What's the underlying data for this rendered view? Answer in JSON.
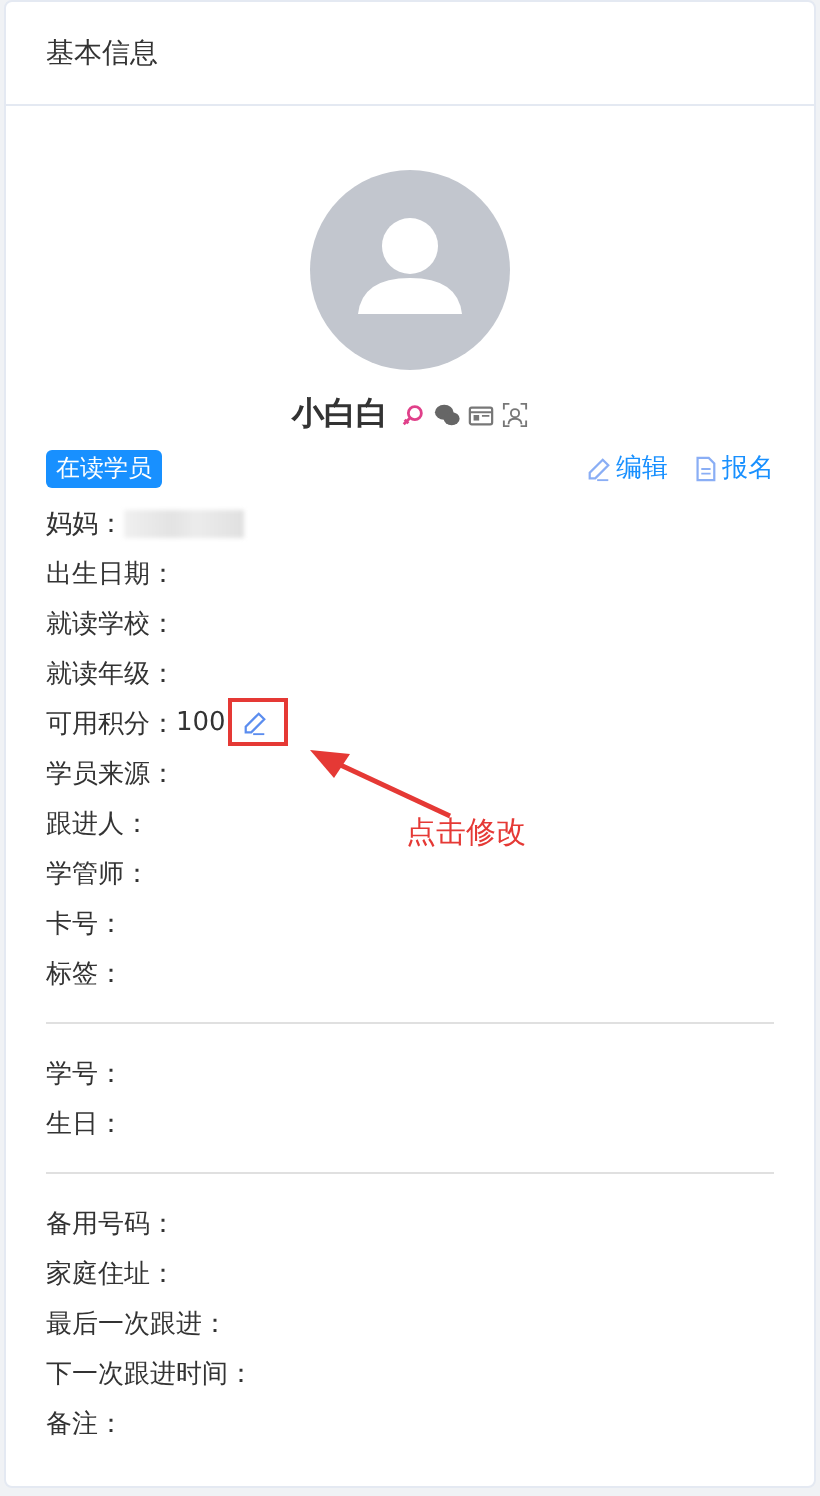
{
  "panel": {
    "title": "基本信息"
  },
  "profile": {
    "name": "小白白",
    "status_badge": "在读学员",
    "actions": [
      "编辑",
      "报名"
    ]
  },
  "field_groups": [
    {
      "fields": [
        {
          "label": "妈妈：",
          "kind": "redacted"
        },
        {
          "label": "出生日期：",
          "kind": "text"
        },
        {
          "label": "就读学校：",
          "kind": "text"
        },
        {
          "label": "就读年级：",
          "kind": "text"
        },
        {
          "label": "可用积分：",
          "kind": "editable",
          "value": "100"
        },
        {
          "label": "学员来源：",
          "kind": "text"
        },
        {
          "label": "跟进人：",
          "kind": "text"
        },
        {
          "label": "学管师：",
          "kind": "text"
        },
        {
          "label": "卡号：",
          "kind": "text"
        },
        {
          "label": "标签：",
          "kind": "text"
        }
      ]
    },
    {
      "fields": [
        {
          "label": "学号：",
          "kind": "text"
        },
        {
          "label": "生日：",
          "kind": "text"
        }
      ]
    },
    {
      "fields": [
        {
          "label": "备用号码：",
          "kind": "text"
        },
        {
          "label": "家庭住址：",
          "kind": "text"
        },
        {
          "label": "最后一次跟进：",
          "kind": "text"
        },
        {
          "label": "下一次跟进时间：",
          "kind": "text"
        },
        {
          "label": "备注：",
          "kind": "text"
        }
      ]
    }
  ],
  "annotation": {
    "text": "点击修改"
  }
}
